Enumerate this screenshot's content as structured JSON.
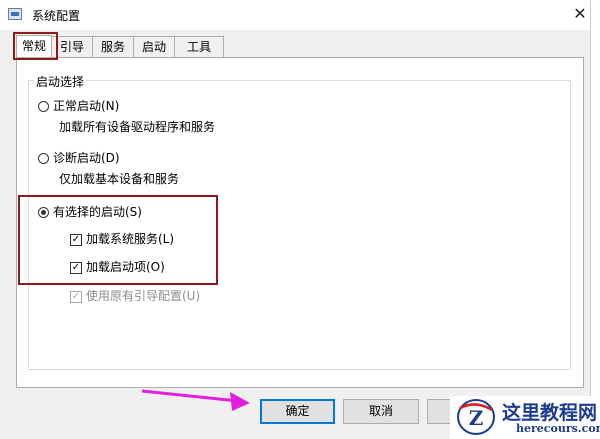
{
  "window": {
    "title": "系统配置",
    "close_glyph": "✕"
  },
  "tabs": [
    {
      "label": "常规",
      "active": true
    },
    {
      "label": "引导",
      "active": false
    },
    {
      "label": "服务",
      "active": false
    },
    {
      "label": "启动",
      "active": false
    },
    {
      "label": "工具",
      "active": false
    }
  ],
  "startup_selection": {
    "legend": "启动选择",
    "normal": {
      "label": "正常启动(N)",
      "description": "加载所有设备驱动程序和服务",
      "selected": false
    },
    "diagnostic": {
      "label": "诊断启动(D)",
      "description": "仅加载基本设备和服务",
      "selected": false
    },
    "selective": {
      "label": "有选择的启动(S)",
      "selected": true,
      "load_system_services": {
        "label": "加载系统服务(L)",
        "checked": true
      },
      "load_startup_items": {
        "label": "加载启动项(O)",
        "checked": true
      },
      "use_original_boot": {
        "label": "使用原有引导配置(U)",
        "checked": true,
        "disabled": true
      }
    }
  },
  "buttons": {
    "ok": "确定",
    "cancel": "取消"
  },
  "watermark": {
    "cn": "这里教程网",
    "en": "herecours.com",
    "logo_letter": "Z"
  },
  "colors": {
    "highlight_box": "#8b1a1a",
    "arrow": "#e020e0",
    "primary_border": "#0078d7",
    "watermark": "#1d3a8f"
  }
}
